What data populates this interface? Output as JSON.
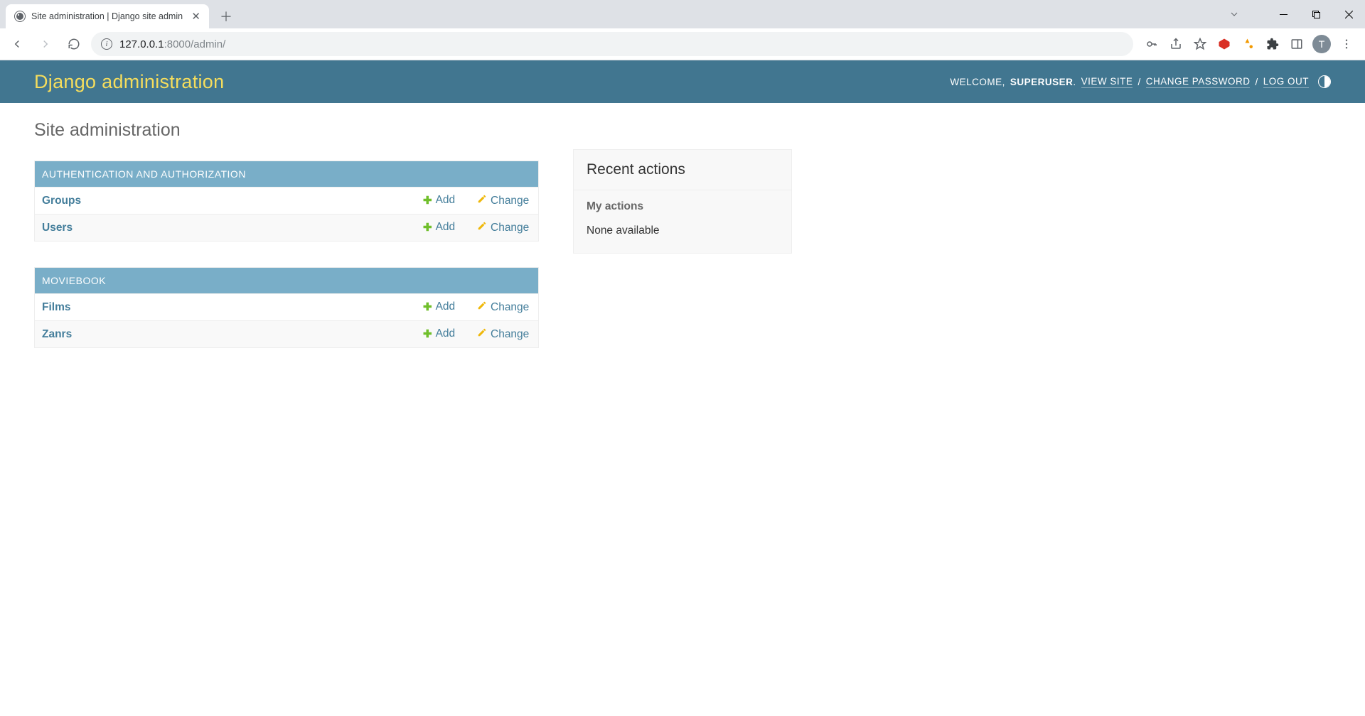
{
  "browser": {
    "tab_title": "Site administration | Django site admin",
    "url_host": "127.0.0.1",
    "url_port_path": ":8000/admin/",
    "avatar_initial": "T"
  },
  "header": {
    "brand": "Django administration",
    "welcome": "WELCOME,",
    "username": "SUPERUSER",
    "view_site": "VIEW SITE",
    "change_password": "CHANGE PASSWORD",
    "log_out": "LOG OUT"
  },
  "page": {
    "title": "Site administration"
  },
  "apps": [
    {
      "label": "AUTHENTICATION AND AUTHORIZATION",
      "models": [
        {
          "name": "Groups",
          "add": "Add",
          "change": "Change"
        },
        {
          "name": "Users",
          "add": "Add",
          "change": "Change"
        }
      ]
    },
    {
      "label": "MOVIEBOOK",
      "models": [
        {
          "name": "Films",
          "add": "Add",
          "change": "Change"
        },
        {
          "name": "Zanrs",
          "add": "Add",
          "change": "Change"
        }
      ]
    }
  ],
  "recent": {
    "heading": "Recent actions",
    "subheading": "My actions",
    "empty": "None available"
  }
}
